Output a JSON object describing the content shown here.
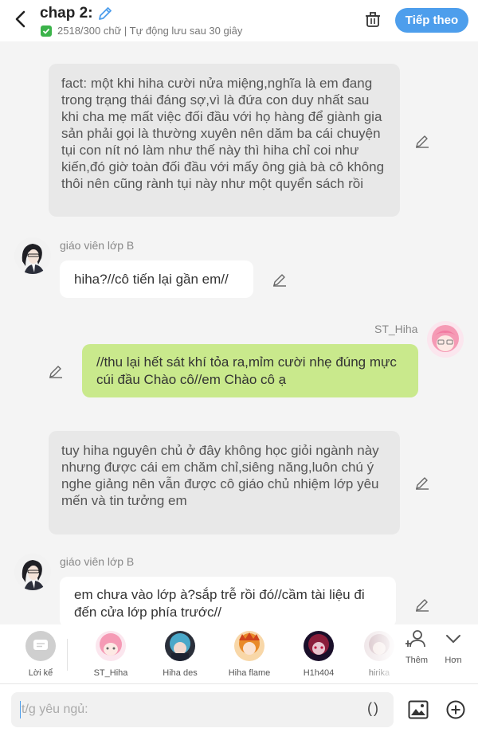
{
  "header": {
    "title": "chap 2:",
    "stats": "2518/300 chữ | Tự động lưu sau 30 giây",
    "next_label": "Tiếp theo"
  },
  "messages": [
    {
      "type": "narration",
      "text": "fact: một khi hiha cười nửa miệng,nghĩa là em đang trong trạng thái đáng sợ,vì là đứa con duy nhất sau khi cha mẹ mất việc đối đầu với họ hàng để giành gia sản phải gọi là thường xuyên nên dăm ba cái chuyện tụi con nít nó làm như thế này thì hiha chỉ coi như kiến,đó giờ toàn đối đầu với mấy ông già bà cô không thôi nên cũng rành tụi này như một quyển sách rồi"
    },
    {
      "type": "left",
      "name": "giáo viên lớp B",
      "text": "hiha?//cô tiến lại gần em//"
    },
    {
      "type": "right",
      "name": "ST_Hiha",
      "text": "//thu lại hết sát khí tỏa ra,mỉm cười nhẹ đúng mực cúi đầu Chào cô//em Chào cô ạ"
    },
    {
      "type": "narration",
      "text": "tuy hiha nguyên chủ ở đây không học giỏi ngành này nhưng được cái em chăm chỉ,siêng năng,luôn chú ý nghe giảng nên vẫn được cô giáo chủ nhiệm lớp yêu mến và tin tưởng em"
    },
    {
      "type": "left",
      "name": "giáo viên lớp B",
      "text": "em chưa vào lớp à?sắp trễ rồi đó//cầm tài liệu đi đến cửa lớp phía trước//"
    }
  ],
  "characters": [
    {
      "label": "Lời kể",
      "color": "#cfcfcf"
    },
    {
      "label": "ST_Hiha",
      "color": "#f4a3b8"
    },
    {
      "label": "Hiha des",
      "color": "#4aa8c9"
    },
    {
      "label": "Hiha flame",
      "color": "#e98a2a"
    },
    {
      "label": "H1h404",
      "color": "#8a1d3a"
    },
    {
      "label": "hirika",
      "color": "#d7c3c8"
    }
  ],
  "actions": {
    "add_label": "Thêm",
    "more_label": "Hơn"
  },
  "input": {
    "placeholder": "t/g yêu ngủ:",
    "paren": "()"
  },
  "colors": {
    "accent": "#4d9eec",
    "green_bubble": "#c9e98c",
    "narration_bg": "#e8e8e8"
  }
}
